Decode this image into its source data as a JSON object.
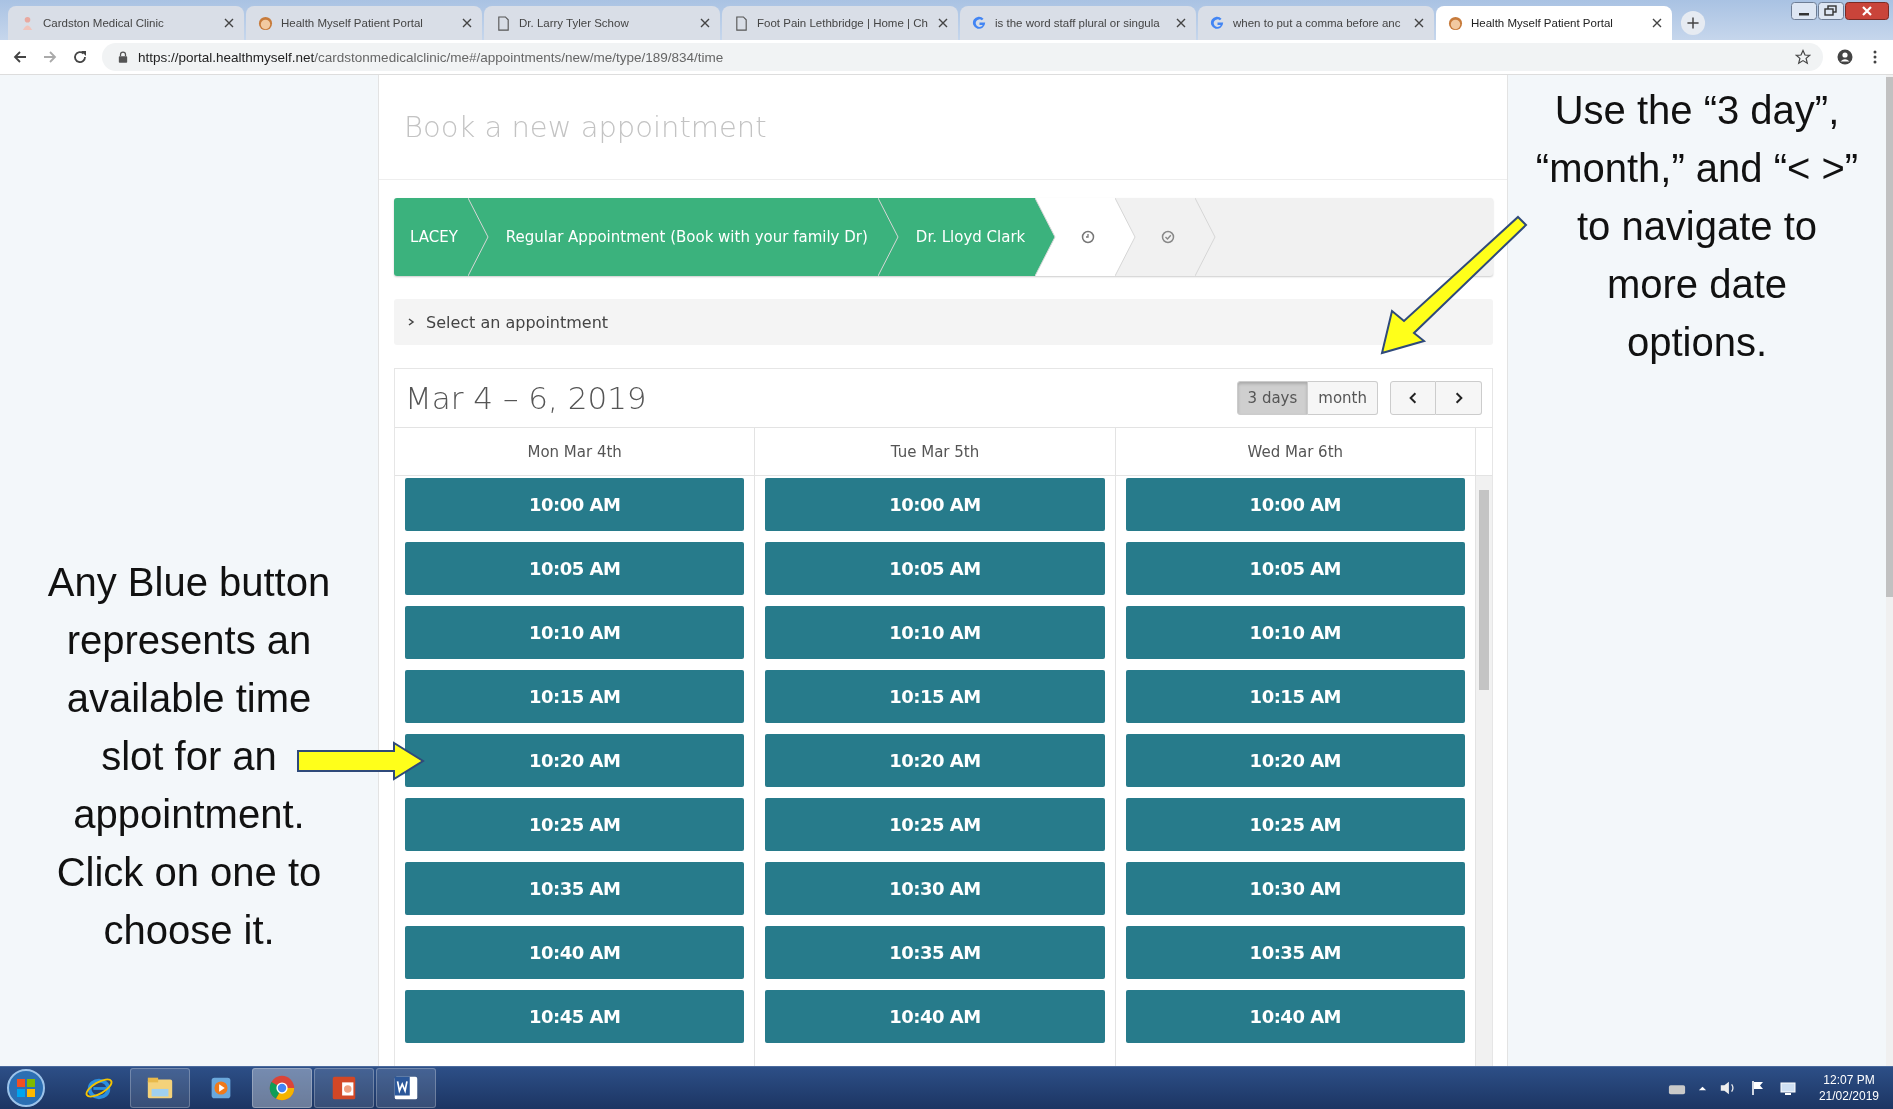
{
  "browser": {
    "tabs": [
      {
        "title": "Cardston Medical Clinic",
        "kind": "person",
        "selected": false
      },
      {
        "title": "Health Myself Patient Portal",
        "kind": "face",
        "selected": false
      },
      {
        "title": "Dr. Larry Tyler Schow",
        "kind": "page",
        "selected": false
      },
      {
        "title": "Foot Pain Lethbridge | Home | Ch",
        "kind": "page",
        "selected": false
      },
      {
        "title": "is the word staff plural or singula",
        "kind": "google",
        "selected": false
      },
      {
        "title": "when to put a comma before anc",
        "kind": "google",
        "selected": false
      },
      {
        "title": "Health Myself Patient Portal",
        "kind": "face",
        "selected": true
      }
    ],
    "url_host": "https://portal.healthmyself.net",
    "url_path": "/cardstonmedicalclinic/me#/appointments/new/me/type/189/834/time"
  },
  "page": {
    "title": "Book a new appointment",
    "steps": [
      {
        "label": "LACEY",
        "kind": "text",
        "completed": true
      },
      {
        "label": "Regular Appointment (Book with your family Dr)",
        "kind": "text",
        "completed": true
      },
      {
        "label": "Dr. Lloyd Clark",
        "kind": "text",
        "completed": true
      },
      {
        "kind": "clock",
        "completed": false
      },
      {
        "kind": "check",
        "completed": false
      }
    ],
    "section": {
      "label": "Select an appointment",
      "expanded": false
    },
    "calendar": {
      "range": "Mar 4 – 6, 2019",
      "views": [
        {
          "label": "3 days",
          "selected": true
        },
        {
          "label": "month",
          "selected": false
        }
      ],
      "columns": [
        {
          "day": "Mon Mar 4th",
          "slots": [
            "10:00 AM",
            "10:05 AM",
            "10:10 AM",
            "10:15 AM",
            "10:20 AM",
            "10:25 AM",
            "10:35 AM",
            "10:40 AM",
            "10:45 AM"
          ]
        },
        {
          "day": "Tue Mar 5th",
          "slots": [
            "10:00 AM",
            "10:05 AM",
            "10:10 AM",
            "10:15 AM",
            "10:20 AM",
            "10:25 AM",
            "10:30 AM",
            "10:35 AM",
            "10:40 AM"
          ]
        },
        {
          "day": "Wed Mar 6th",
          "slots": [
            "10:00 AM",
            "10:05 AM",
            "10:10 AM",
            "10:15 AM",
            "10:20 AM",
            "10:25 AM",
            "10:30 AM",
            "10:35 AM",
            "10:40 AM"
          ]
        }
      ]
    }
  },
  "annotations": {
    "left": "Any Blue button represents an available time slot for an appointment. Click on one to choose it.",
    "right": "Use the “3 day”, “month,” and “< >” to navigate to more date options."
  },
  "taskbar": {
    "time": "12:07 PM",
    "date": "21/02/2019"
  }
}
